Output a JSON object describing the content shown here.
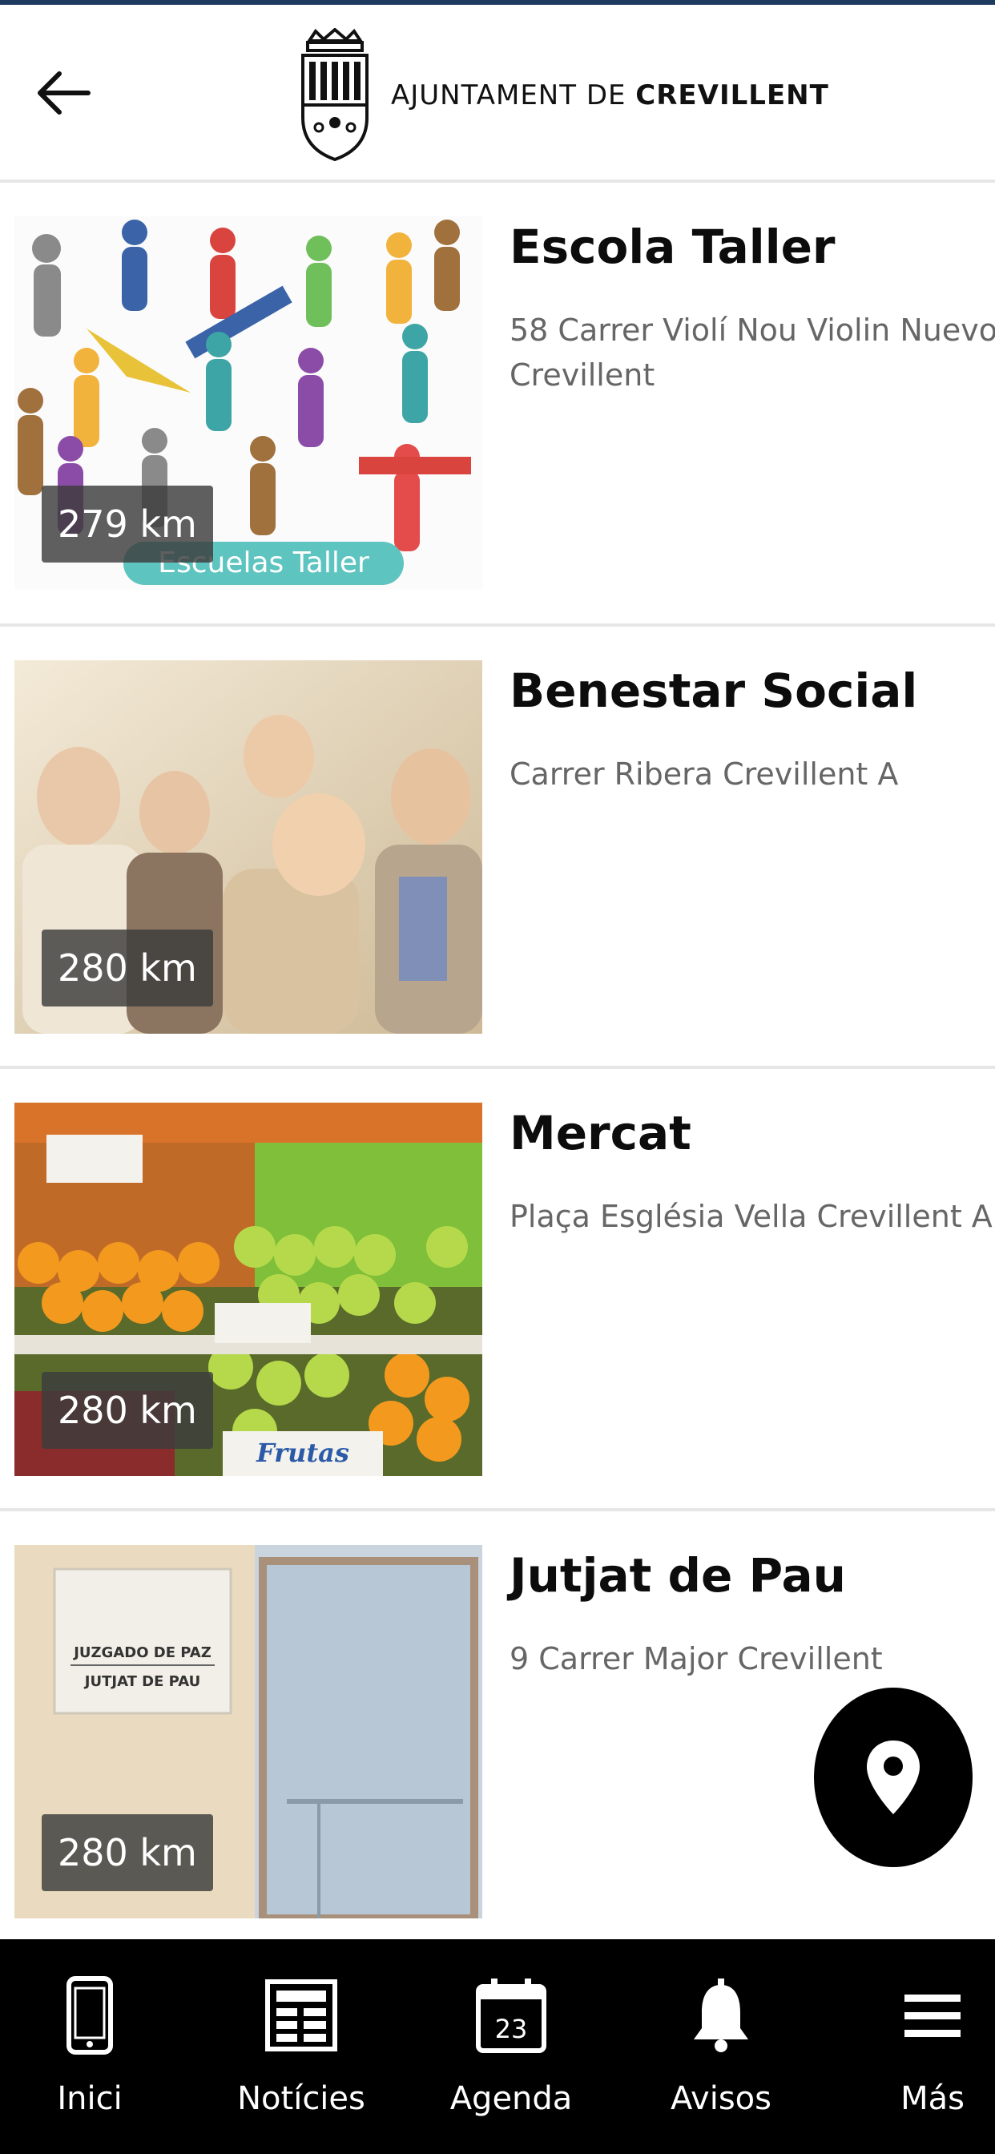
{
  "header": {
    "logo_text_light": "AJUNTAMENT DE",
    "logo_text_bold": "CREVILLENT"
  },
  "places": [
    {
      "title": "Escola Taller",
      "address_line1": "58 Carrer Violí Nou Violin Nuevo",
      "address_line2": "Crevillent",
      "distance": "279 km",
      "image_caption": "Escuelas Taller"
    },
    {
      "title": "Benestar Social",
      "address_line1": "Carrer Ribera Crevillent A",
      "address_line2": "",
      "distance": "280 km"
    },
    {
      "title": "Mercat",
      "address_line1": "Plaça Església Vella Crevillent A",
      "address_line2": "",
      "distance": "280 km",
      "image_caption": "Frutas"
    },
    {
      "title": "Jutjat de Pau",
      "address_line1": "9 Carrer Major Crevillent",
      "address_line2": "",
      "distance": "280 km",
      "image_caption_line1": "JUZGADO DE PAZ",
      "image_caption_line2": "JUTJAT DE PAU"
    }
  ],
  "fab": {
    "icon": "location-pin-icon"
  },
  "tabbar": {
    "items": [
      {
        "label": "Inici",
        "icon": "phone-icon"
      },
      {
        "label": "Notícies",
        "icon": "newspaper-icon"
      },
      {
        "label": "Agenda",
        "icon": "calendar-icon",
        "calendar_day": "23"
      },
      {
        "label": "Avisos",
        "icon": "bell-icon"
      },
      {
        "label": "Más",
        "icon": "menu-icon"
      }
    ]
  },
  "colors": {
    "top_strip": "#1f3a5f",
    "tabbar_bg": "#000000",
    "distance_badge_bg": "#3c3c3c"
  }
}
